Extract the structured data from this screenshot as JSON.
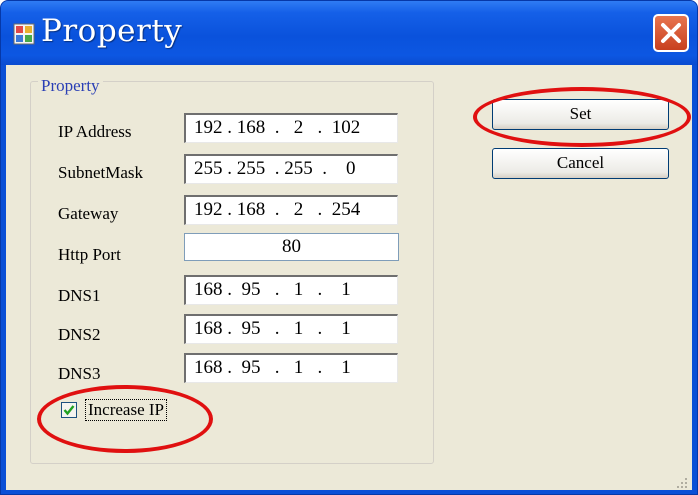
{
  "window": {
    "title": "Property"
  },
  "group": {
    "title": "Property"
  },
  "fields": {
    "ip_address": {
      "label": "IP Address",
      "value": "192 . 168  .   2   .  102"
    },
    "subnet_mask": {
      "label": "SubnetMask",
      "value": "255 . 255  . 255  .    0"
    },
    "gateway": {
      "label": "Gateway",
      "value": "192 . 168  .   2   .  254"
    },
    "http_port": {
      "label": "Http Port",
      "value": "80"
    },
    "dns1": {
      "label": "DNS1",
      "value": "168 .  95   .   1   .    1"
    },
    "dns2": {
      "label": "DNS2",
      "value": "168 .  95   .   1   .    1"
    },
    "dns3": {
      "label": "DNS3",
      "value": "168 .  95   .   1   .    1"
    }
  },
  "increase_ip": {
    "label": "Increase IP",
    "checked": true
  },
  "buttons": {
    "set": "Set",
    "cancel": "Cancel"
  },
  "colors": {
    "titlebar": "#0a52dc",
    "client": "#ece9d8",
    "highlight_ring": "#e01010",
    "close": "#c8401f"
  }
}
